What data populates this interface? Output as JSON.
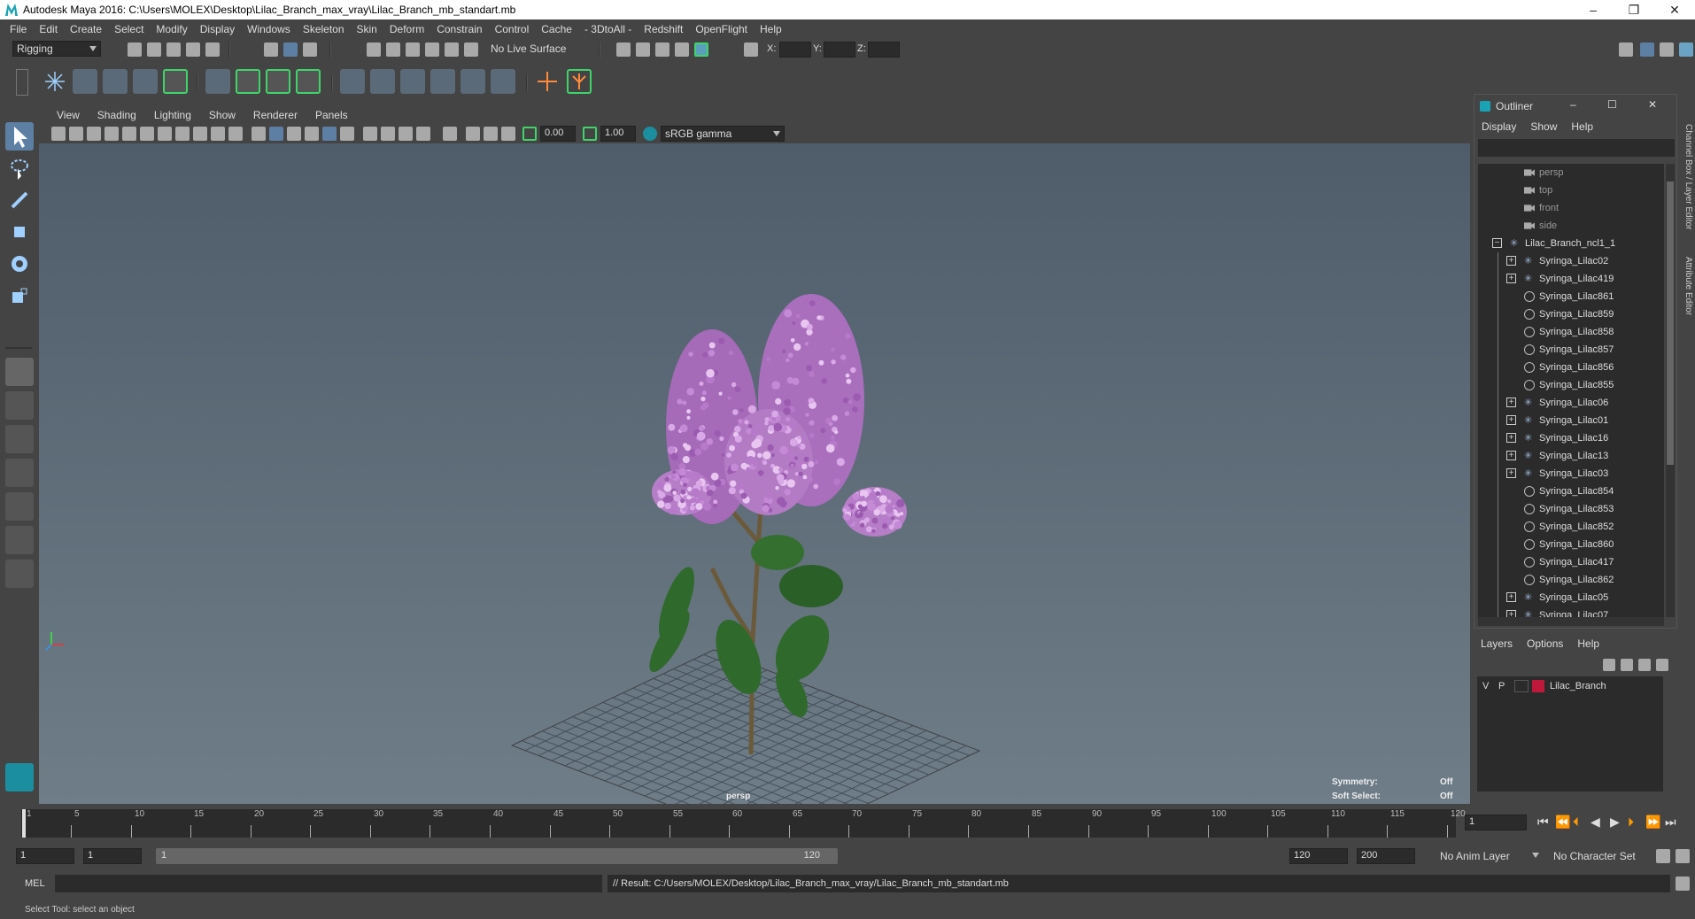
{
  "window": {
    "title": "Autodesk Maya 2016: C:\\Users\\MOLEX\\Desktop\\Lilac_Branch_max_vray\\Lilac_Branch_mb_standart.mb",
    "minimize": "–",
    "maximize": "❐",
    "close": "✕"
  },
  "menubar": [
    "File",
    "Edit",
    "Create",
    "Select",
    "Modify",
    "Display",
    "Windows",
    "Skeleton",
    "Skin",
    "Deform",
    "Constrain",
    "Control",
    "Cache",
    "- 3DtoAll -",
    "Redshift",
    "OpenFlight",
    "Help"
  ],
  "statusline": {
    "menu_set": "Rigging",
    "live_surface": "No Live Surface",
    "x_label": "X:",
    "y_label": "Y:",
    "z_label": "Z:"
  },
  "viewport": {
    "menus": [
      "View",
      "Shading",
      "Lighting",
      "Show",
      "Renderer",
      "Panels"
    ],
    "exposure": "0.00",
    "gamma": "1.00",
    "color_space": "sRGB gamma",
    "camera_label": "persp",
    "symmetry_label": "Symmetry:",
    "symmetry_value": "Off",
    "soft_select_label": "Soft Select:",
    "soft_select_value": "Off"
  },
  "outliner": {
    "title": "Outliner",
    "menus": [
      "Display",
      "Show",
      "Help"
    ],
    "items": [
      {
        "label": "persp",
        "type": "camera",
        "expand": false
      },
      {
        "label": "top",
        "type": "camera",
        "expand": false
      },
      {
        "label": "front",
        "type": "camera",
        "expand": false
      },
      {
        "label": "side",
        "type": "camera",
        "expand": false
      },
      {
        "label": "Lilac_Branch_ncl1_1",
        "type": "root",
        "expand": true
      },
      {
        "label": "Syringa_Lilac02",
        "type": "group",
        "expand": true
      },
      {
        "label": "Syringa_Lilac419",
        "type": "group",
        "expand": true
      },
      {
        "label": "Syringa_Lilac861",
        "type": "mesh",
        "expand": false
      },
      {
        "label": "Syringa_Lilac859",
        "type": "mesh",
        "expand": false
      },
      {
        "label": "Syringa_Lilac858",
        "type": "mesh",
        "expand": false
      },
      {
        "label": "Syringa_Lilac857",
        "type": "mesh",
        "expand": false
      },
      {
        "label": "Syringa_Lilac856",
        "type": "mesh",
        "expand": false
      },
      {
        "label": "Syringa_Lilac855",
        "type": "mesh",
        "expand": false
      },
      {
        "label": "Syringa_Lilac06",
        "type": "group",
        "expand": true
      },
      {
        "label": "Syringa_Lilac01",
        "type": "group",
        "expand": true
      },
      {
        "label": "Syringa_Lilac16",
        "type": "group",
        "expand": true
      },
      {
        "label": "Syringa_Lilac13",
        "type": "group",
        "expand": true
      },
      {
        "label": "Syringa_Lilac03",
        "type": "group",
        "expand": true
      },
      {
        "label": "Syringa_Lilac854",
        "type": "mesh",
        "expand": false
      },
      {
        "label": "Syringa_Lilac853",
        "type": "mesh",
        "expand": false
      },
      {
        "label": "Syringa_Lilac852",
        "type": "mesh",
        "expand": false
      },
      {
        "label": "Syringa_Lilac860",
        "type": "mesh",
        "expand": false
      },
      {
        "label": "Syringa_Lilac417",
        "type": "mesh",
        "expand": false
      },
      {
        "label": "Syringa_Lilac862",
        "type": "mesh",
        "expand": false
      },
      {
        "label": "Syringa_Lilac05",
        "type": "group",
        "expand": true
      },
      {
        "label": "Syringa_Lilac07",
        "type": "group",
        "expand": true
      }
    ]
  },
  "side_tabs": [
    "Channel Box / Layer Editor",
    "Attribute Editor"
  ],
  "layers": {
    "menus": [
      "Layers",
      "Options",
      "Help"
    ],
    "layer": {
      "v": "V",
      "p": "P",
      "name": "Lilac_Branch",
      "color": "#c0183a"
    }
  },
  "timeline": {
    "tick_labels": [
      "1",
      "5",
      "10",
      "15",
      "20",
      "25",
      "30",
      "35",
      "40",
      "45",
      "50",
      "55",
      "60",
      "65",
      "70",
      "75",
      "80",
      "85",
      "90",
      "95",
      "100",
      "105",
      "110",
      "115",
      "120"
    ],
    "current_frame": "1"
  },
  "range": {
    "start": "1",
    "playback_start": "1",
    "slider_start": "1",
    "slider_end": "120",
    "playback_end": "120",
    "end": "200",
    "anim_layer": "No Anim Layer",
    "char_set": "No Character Set"
  },
  "cmd": {
    "label": "MEL",
    "result": "// Result: C:/Users/MOLEX/Desktop/Lilac_Branch_max_vray/Lilac_Branch_mb_standart.mb"
  },
  "help": "Select Tool: select an object"
}
